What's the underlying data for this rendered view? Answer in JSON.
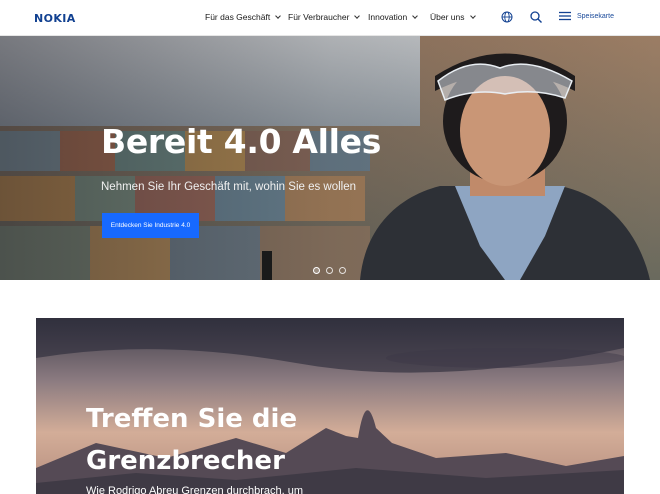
{
  "brand": {
    "logo": "NOKIA",
    "accent": "#124191",
    "cta_color": "#1769ff"
  },
  "nav": {
    "items": [
      {
        "label": "Für das Geschäft"
      },
      {
        "label": "Für Verbraucher"
      },
      {
        "label": "Innovation"
      },
      {
        "label": "Über uns"
      }
    ],
    "globe_icon": "globe-icon",
    "search_icon": "search-icon",
    "menu_icon": "hamburger-icon",
    "menu_label": "Speisekarte"
  },
  "hero": {
    "title": "Bereit 4.0 Alles",
    "subtitle": "Nehmen Sie Ihr Geschäft mit, wohin Sie es wollen",
    "cta_label": "Entdecken Sie Industrie 4.0",
    "slides_total": 3,
    "active_slide": 1
  },
  "section": {
    "title_line1": "Treffen Sie die",
    "title_line2": "Grenzbrecher",
    "subtitle": "Wie Rodrigo Abreu Grenzen durchbrach, um"
  }
}
